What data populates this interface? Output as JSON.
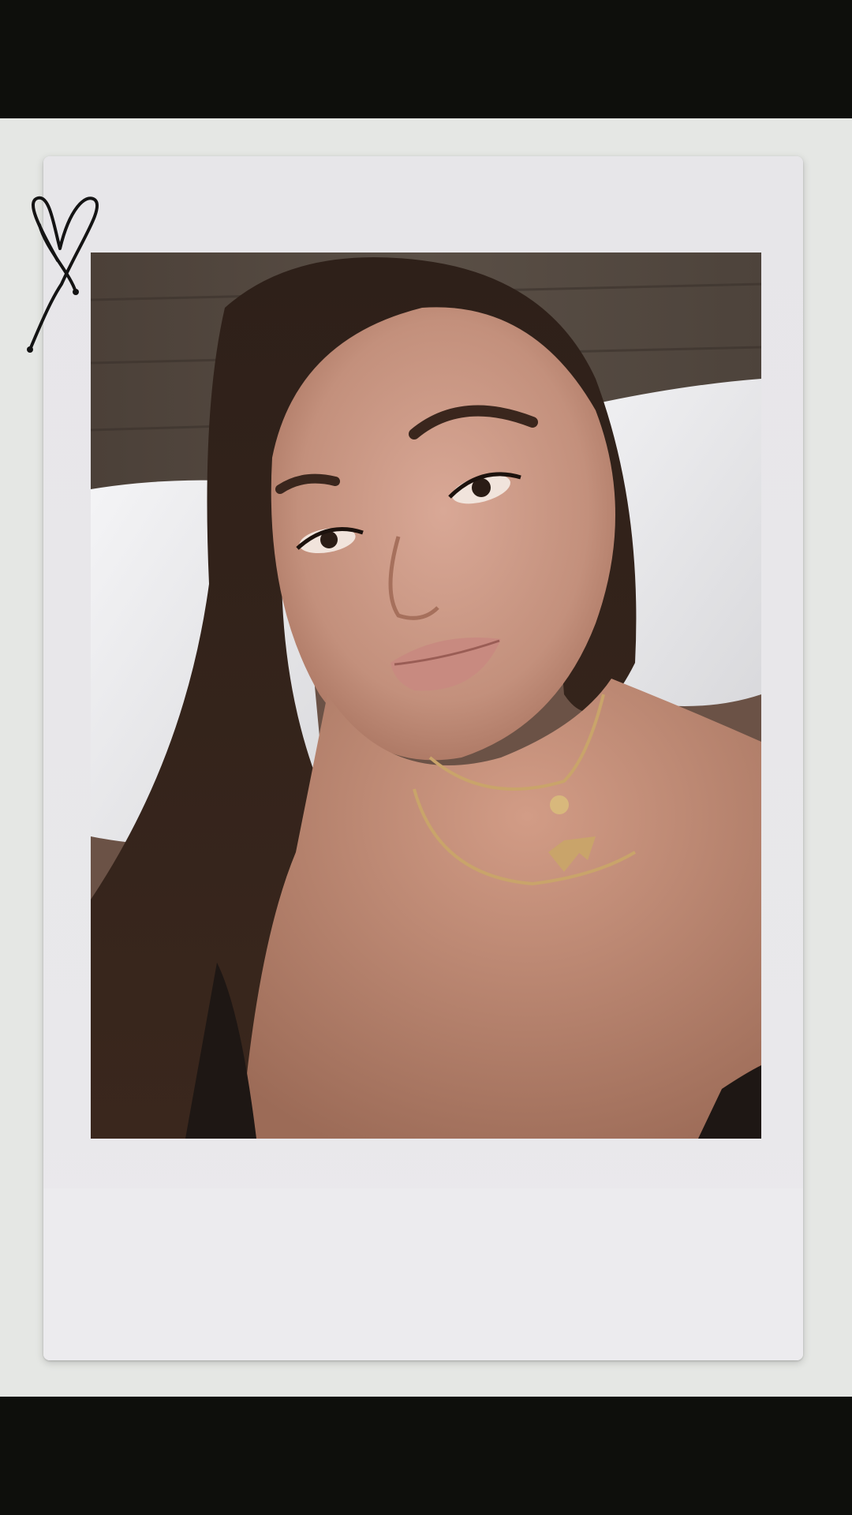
{
  "scene": {
    "description_icons": [
      "heart-doodle-icon"
    ],
    "colors": {
      "letterbox": "#0e0f0c",
      "backdrop": "#e5e7e4",
      "frame": "#e8e7ea",
      "headboard": "#4a413a",
      "pillow": "#f1f1f3",
      "hair": "#2b1d16",
      "skin": "#c99482",
      "necklace": "#c9a46a"
    }
  }
}
